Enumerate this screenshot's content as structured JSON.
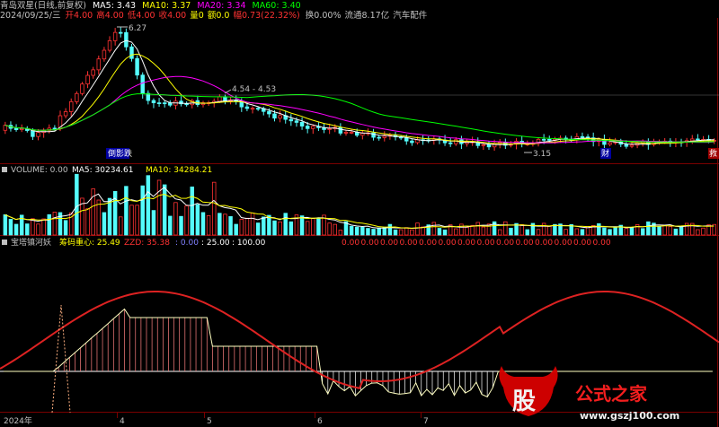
{
  "app": {
    "title": "青岛双星(日线,前复权)"
  },
  "header": {
    "ma5": "MA5: 3.43",
    "ma10": "MA10: 3.37",
    "ma20": "MA20: 3.34",
    "ma60": "MA60: 3.40"
  },
  "quote": {
    "date": "2024/09/25/三",
    "open": "开4.00",
    "high": "高4.00",
    "low": "低4.00",
    "close": "收4.00",
    "volume": "量0",
    "amount": "额0.0",
    "change": "幅0.73(22.32%)",
    "turnover": "换0.00%",
    "float": "流通8.17亿",
    "sector": "汽车配件"
  },
  "price_chart": {
    "peak_label": "6.27",
    "range_label": "4.54 - 4.53",
    "low_label": "3.15",
    "marker_left": "倒影跌",
    "marker_cai": "财",
    "marker_edge": "救"
  },
  "volume_panel": {
    "title": "VOLUME: 0.00",
    "ma5": "MA5: 30234.61",
    "ma10": "MA10: 34284.21"
  },
  "indicator_panel": {
    "name": "宝塔镇河妖",
    "line1": "筹码重心: 25.49",
    "line2": "ZZD: 35.38",
    "line3": ": 0.00",
    "line4": ": 25.00",
    "line5": ": 100.00",
    "zeros": [
      "0.00",
      "0.00",
      "0.00",
      "0.00",
      "0.00",
      "0.00",
      "0.00",
      "0.00",
      "0.00",
      "0.00",
      "0.00",
      "0.00",
      "0.00",
      "0.00"
    ]
  },
  "x_axis": {
    "labels": [
      "2024年",
      "4",
      "5",
      "6",
      "7"
    ]
  },
  "watermark": {
    "char": "股",
    "text": "公式之家",
    "url": "www.gszj100.com"
  },
  "colors": {
    "up": "#ff3232",
    "down": "#54fcfc",
    "ma5": "#ffffff",
    "ma10": "#ffff00",
    "ma20": "#ff00ff",
    "ma60": "#00ff00"
  }
}
